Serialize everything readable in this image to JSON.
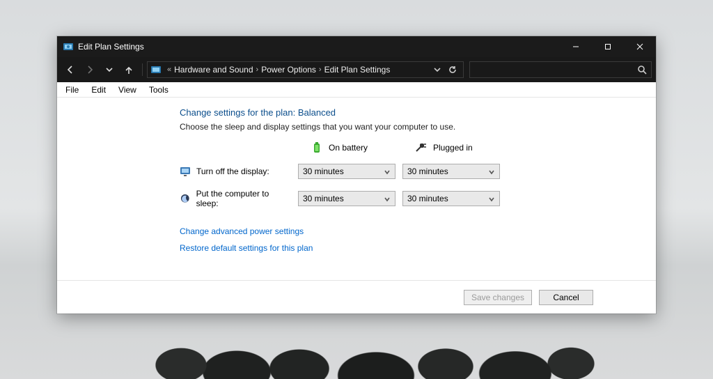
{
  "window": {
    "title": "Edit Plan Settings"
  },
  "breadcrumb": {
    "prefix": "«",
    "items": [
      "Hardware and Sound",
      "Power Options",
      "Edit Plan Settings"
    ]
  },
  "menubar": [
    "File",
    "Edit",
    "View",
    "Tools"
  ],
  "page": {
    "heading": "Change settings for the plan: Balanced",
    "description": "Choose the sleep and display settings that you want your computer to use.",
    "columns": {
      "battery": "On battery",
      "plugged": "Plugged in"
    },
    "rows": {
      "display": {
        "label": "Turn off the display:",
        "battery_value": "30 minutes",
        "plugged_value": "30 minutes"
      },
      "sleep": {
        "label": "Put the computer to sleep:",
        "battery_value": "30 minutes",
        "plugged_value": "30 minutes"
      }
    },
    "links": {
      "advanced": "Change advanced power settings",
      "restore": "Restore default settings for this plan"
    },
    "buttons": {
      "save": "Save changes",
      "cancel": "Cancel"
    }
  },
  "search": {
    "placeholder": ""
  }
}
